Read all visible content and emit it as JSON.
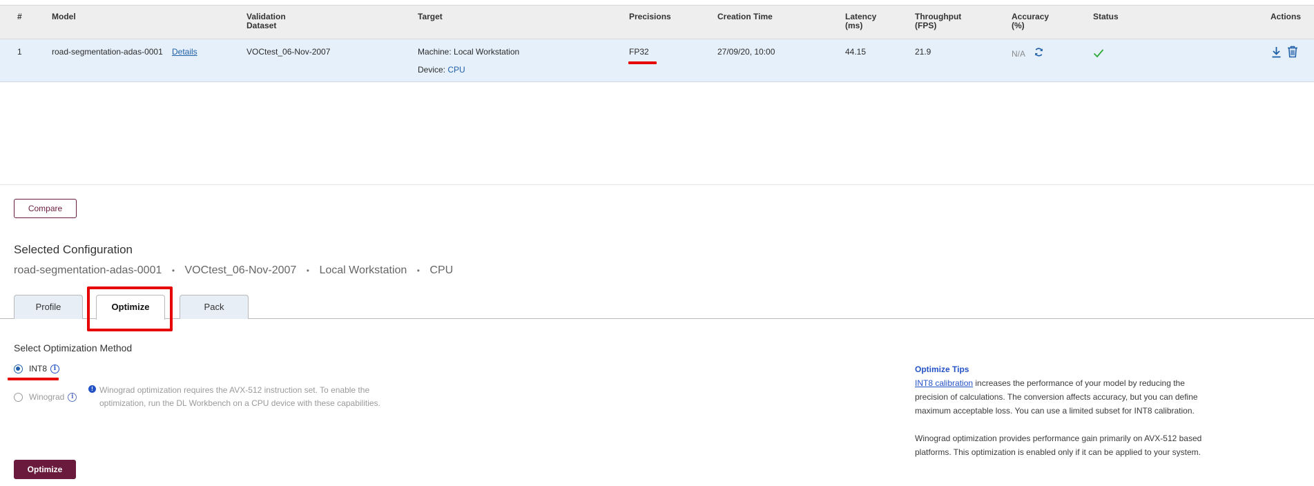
{
  "table": {
    "headers": {
      "index": "#",
      "model": "Model",
      "validation_dataset_1": "Validation",
      "validation_dataset_2": "Dataset",
      "target": "Target",
      "precisions": "Precisions",
      "creation_time": "Creation Time",
      "latency_1": "Latency",
      "latency_2": "(ms)",
      "throughput_1": "Throughput",
      "throughput_2": "(FPS)",
      "accuracy_1": "Accuracy",
      "accuracy_2": "(%)",
      "status": "Status",
      "actions": "Actions"
    },
    "rows": [
      {
        "index": "1",
        "model": "road-segmentation-adas-0001",
        "details_link": "Details",
        "dataset": "VOCtest_06-Nov-2007",
        "target_machine": "Machine: Local Workstation",
        "device_label": "Device:",
        "device_value": "CPU",
        "precision": "FP32",
        "creation_time": "27/09/20, 10:00",
        "latency": "44.15",
        "throughput": "21.9",
        "accuracy": "N/A",
        "status": "success"
      }
    ]
  },
  "compare_label": "Compare",
  "selected": {
    "title": "Selected Configuration",
    "model": "road-segmentation-adas-0001",
    "dataset": "VOCtest_06-Nov-2007",
    "machine": "Local Workstation",
    "device": "CPU",
    "separator": "•"
  },
  "tabs": [
    {
      "label": "Profile",
      "active": false
    },
    {
      "label": "Optimize",
      "active": true
    },
    {
      "label": "Pack",
      "active": false
    }
  ],
  "optimization": {
    "title": "Select Optimization Method",
    "options": [
      {
        "label": "INT8",
        "checked": true
      },
      {
        "label": "Winograd",
        "checked": false
      }
    ],
    "warning": "Winograd optimization requires the AVX-512 instruction set. To enable the optimization, run the DL Workbench on a CPU device with these capabilities.",
    "button": "Optimize"
  },
  "tips": {
    "title": "Optimize Tips",
    "int8_link": "INT8 calibration",
    "int8_text": " increases the performance of your model by reducing the precision of calculations. The conversion affects accuracy, but you can define maximum acceptable loss. You can use a limited subset for INT8 calibration.",
    "winograd_text": "Winograd optimization provides performance gain primarily on AVX-512 based platforms. This optimization is enabled only if it can be applied to your system."
  },
  "colors": {
    "accent": "#6a1a3c",
    "link": "#1f5fa8",
    "highlight": "#e60000",
    "row_bg": "#e6f0fa",
    "success": "#2eaa3a"
  }
}
